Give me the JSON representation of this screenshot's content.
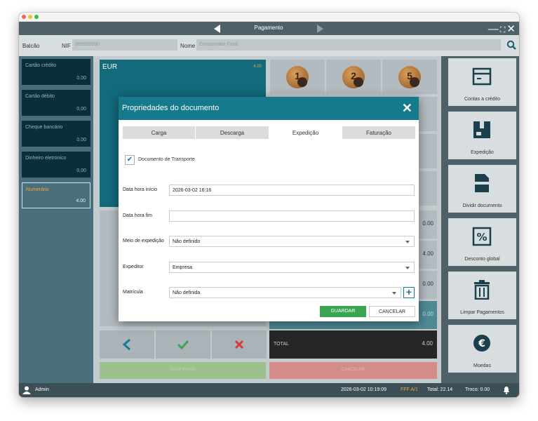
{
  "window": {
    "title": "Pagamento"
  },
  "customer": {
    "balcao_label": "Balcão",
    "nif_label": "NIF",
    "nif_value": "999999990",
    "nome_label": "Nome",
    "nome_value": "Consumidor Final"
  },
  "payment_methods": [
    {
      "name": "Cartão crédito",
      "amount": "0.00"
    },
    {
      "name": "Cartão débito",
      "amount": "0.00"
    },
    {
      "name": "Cheque bancário",
      "amount": "0.00"
    },
    {
      "name": "Dinheiro eletrónico",
      "amount": "0.00"
    },
    {
      "name": "Numerário",
      "amount": "4.00"
    }
  ],
  "currency": {
    "code": "EUR",
    "amount": "4.00"
  },
  "coins": [
    {
      "label": "1"
    },
    {
      "label": "2"
    },
    {
      "label": "5"
    }
  ],
  "amount_boxes": [
    "0.00",
    "4.00",
    "0.00",
    "0.00"
  ],
  "total": {
    "label": "TOTAL",
    "value": "4.00"
  },
  "actions": {
    "confirm": "CONFIRMAR",
    "cancel": "CANCELAR"
  },
  "right_buttons": [
    {
      "label": "Contas a crédito",
      "icon": "invoice-icon"
    },
    {
      "label": "Expedição",
      "icon": "shipping-box-icon"
    },
    {
      "label": "Dividir documento",
      "icon": "split-document-icon"
    },
    {
      "label": "Desconto global",
      "icon": "percent-icon"
    },
    {
      "label": "Limpar Pagamentos",
      "icon": "trash-icon"
    },
    {
      "label": "Moedas",
      "icon": "euro-icon"
    }
  ],
  "status": {
    "user": "Admin",
    "datetime": "2026-03-02 10:19:09",
    "doc": "FFF A/1",
    "total": "Total:  22.14",
    "troco": "Troco:  0.00"
  },
  "modal": {
    "title": "Propriedades do documento",
    "tabs": [
      "Carga",
      "Descarga",
      "Expedição",
      "Faturação"
    ],
    "active_tab": "Expedição",
    "checkbox_label": "Documento de Transporte",
    "fields": {
      "start_label": "Data hora início",
      "start_value": "2026-03-02 16:16",
      "end_label": "Data hora fim",
      "end_value": "",
      "meio_label": "Meio de expedição",
      "meio_value": "Não definido",
      "expeditor_label": "Expeditor",
      "expeditor_value": "Empresa",
      "matricula_label": "Matrícula",
      "matricula_value": "Não definida"
    },
    "save": "GUARDAR",
    "cancel": "CANCELAR"
  },
  "colors": {
    "teal": "#147a8c",
    "green": "#3aa653",
    "orange": "#f2a533",
    "red": "#d9383a"
  }
}
